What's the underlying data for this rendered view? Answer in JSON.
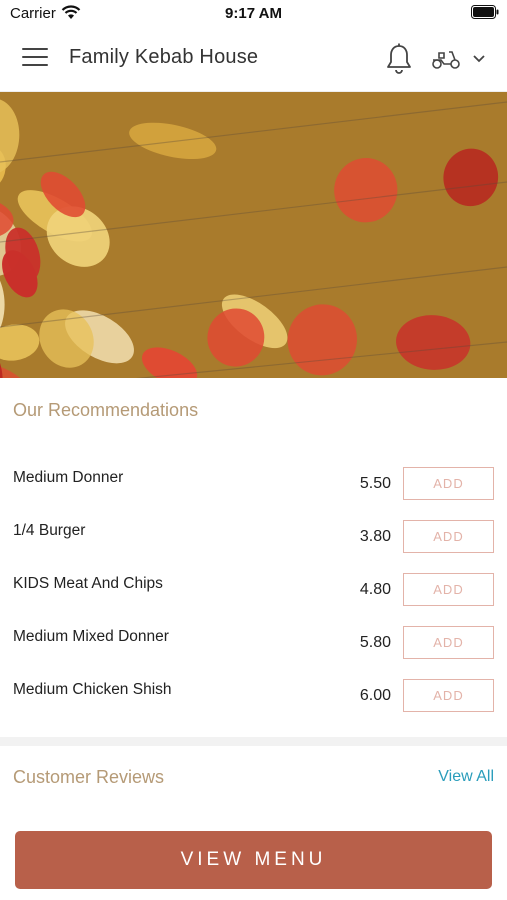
{
  "status_bar": {
    "carrier": "Carrier",
    "time": "9:17 AM"
  },
  "header": {
    "title": "Family Kebab House",
    "icons": [
      "menu-icon",
      "bell-icon",
      "delivery-scooter-icon",
      "chevron-down-icon"
    ]
  },
  "hero": {
    "image": "chicken and pepper kebab skewers"
  },
  "recommendations": {
    "title": "Our Recommendations",
    "add_label": "ADD",
    "items": [
      {
        "name": "Medium Donner",
        "price": "5.50"
      },
      {
        "name": "1/4  Burger",
        "price": "3.80"
      },
      {
        "name": "KIDS Meat And Chips",
        "price": "4.80"
      },
      {
        "name": "Medium Mixed Donner",
        "price": "5.80"
      },
      {
        "name": "Medium Chicken Shish",
        "price": "6.00"
      }
    ]
  },
  "reviews": {
    "title": "Customer Reviews",
    "view_all": "View All"
  },
  "footer": {
    "view_menu": "VIEW MENU"
  },
  "colors": {
    "accent": "#b8604a",
    "section_title": "#b59a76",
    "link": "#2a9dbb",
    "add_border": "#e3b3a9"
  }
}
